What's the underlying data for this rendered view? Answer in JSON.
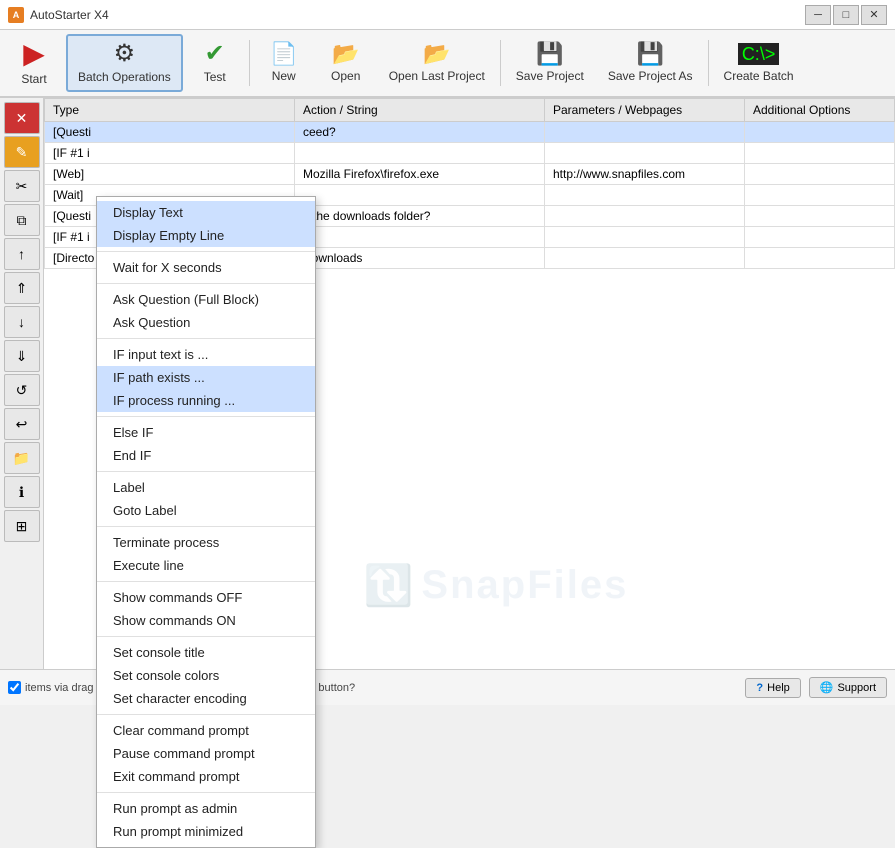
{
  "app": {
    "title": "AutoStarter X4",
    "title_icon": "A"
  },
  "title_controls": {
    "minimize": "─",
    "maximize": "□",
    "close": "✕"
  },
  "toolbar": {
    "buttons": [
      {
        "id": "start",
        "label": "Start",
        "icon": "▶",
        "color": "#cc2222",
        "active": false
      },
      {
        "id": "batch-ops",
        "label": "Batch Operations",
        "icon": "⚙",
        "color": "#555",
        "active": true
      },
      {
        "id": "test",
        "label": "Test",
        "icon": "✔",
        "color": "#339933",
        "active": false
      },
      {
        "id": "new",
        "label": "New",
        "icon": "📄",
        "color": "#555",
        "active": false
      },
      {
        "id": "open",
        "label": "Open",
        "icon": "📂",
        "color": "#cc8800",
        "active": false
      },
      {
        "id": "open-last",
        "label": "Open Last Project",
        "icon": "📂",
        "color": "#cc8800",
        "active": false
      },
      {
        "id": "save",
        "label": "Save Project",
        "icon": "💾",
        "color": "#555",
        "active": false
      },
      {
        "id": "save-as",
        "label": "Save Project As",
        "icon": "💾",
        "color": "#555",
        "active": false
      },
      {
        "id": "create-batch",
        "label": "Create Batch",
        "icon": "🖥",
        "color": "#333",
        "active": false
      }
    ]
  },
  "table": {
    "headers": [
      "Type",
      "Action / String",
      "Parameters / Webpages",
      "Additional Options"
    ],
    "rows": [
      {
        "type": "[Questi",
        "action": "ceed?",
        "params": "",
        "options": ""
      },
      {
        "type": "[IF #1 i",
        "action": "",
        "params": "",
        "options": ""
      },
      {
        "type": "[Web]",
        "action": "Mozilla Firefox\\firefox.exe",
        "params": "http://www.snapfiles.com",
        "options": ""
      },
      {
        "type": "[Wait]",
        "action": "",
        "params": "",
        "options": ""
      },
      {
        "type": "[Questi",
        "action": "n the downloads folder?",
        "params": "",
        "options": ""
      },
      {
        "type": "[IF #1 i",
        "action": "",
        "params": "",
        "options": ""
      },
      {
        "type": "[Directo",
        "action": "Downloads",
        "params": "",
        "options": ""
      }
    ]
  },
  "sidebar_buttons": [
    {
      "id": "delete",
      "icon": "✕",
      "class": "red",
      "tooltip": "Delete"
    },
    {
      "id": "edit",
      "icon": "✎",
      "class": "orange",
      "tooltip": "Edit"
    },
    {
      "id": "scissors",
      "icon": "✂",
      "class": "",
      "tooltip": "Cut"
    },
    {
      "id": "copy",
      "icon": "⧉",
      "class": "",
      "tooltip": "Copy"
    },
    {
      "id": "up",
      "icon": "↑",
      "class": "",
      "tooltip": "Move Up"
    },
    {
      "id": "double-up",
      "icon": "⇑",
      "class": "",
      "tooltip": "Move to Top"
    },
    {
      "id": "down",
      "icon": "↓",
      "class": "",
      "tooltip": "Move Down"
    },
    {
      "id": "double-down",
      "icon": "⇓",
      "class": "",
      "tooltip": "Move to Bottom"
    },
    {
      "id": "refresh",
      "icon": "↺",
      "class": "",
      "tooltip": "Refresh"
    },
    {
      "id": "back",
      "icon": "↩",
      "class": "",
      "tooltip": "Undo"
    },
    {
      "id": "folder",
      "icon": "📁",
      "class": "",
      "tooltip": "Folder"
    },
    {
      "id": "info",
      "icon": "ℹ",
      "class": "",
      "tooltip": "Info"
    },
    {
      "id": "grid",
      "icon": "⊞",
      "class": "",
      "tooltip": "Grid"
    }
  ],
  "dropdown_menu": {
    "items": [
      {
        "id": "display-text",
        "label": "Display Text",
        "separator_after": false,
        "highlighted": true
      },
      {
        "id": "display-empty-line",
        "label": "Display Empty Line",
        "separator_after": true,
        "highlighted": true
      },
      {
        "id": "wait-for-x",
        "label": "Wait for X seconds",
        "separator_after": true,
        "highlighted": false
      },
      {
        "id": "ask-question-full",
        "label": "Ask Question (Full Block)",
        "separator_after": false,
        "highlighted": false
      },
      {
        "id": "ask-question",
        "label": "Ask Question",
        "separator_after": true,
        "highlighted": false
      },
      {
        "id": "if-input-text",
        "label": "IF input text is ...",
        "separator_after": false,
        "highlighted": false
      },
      {
        "id": "if-path-exists",
        "label": "IF path exists ...",
        "separator_after": false,
        "highlighted": true
      },
      {
        "id": "if-process-running",
        "label": "IF process running ...",
        "separator_after": true,
        "highlighted": true
      },
      {
        "id": "else-if",
        "label": "Else IF",
        "separator_after": false,
        "highlighted": false
      },
      {
        "id": "end-if",
        "label": "End IF",
        "separator_after": true,
        "highlighted": false
      },
      {
        "id": "label",
        "label": "Label",
        "separator_after": false,
        "highlighted": false
      },
      {
        "id": "goto-label",
        "label": "Goto Label",
        "separator_after": true,
        "highlighted": false
      },
      {
        "id": "terminate-process",
        "label": "Terminate process",
        "separator_after": false,
        "highlighted": false
      },
      {
        "id": "execute-line",
        "label": "Execute line",
        "separator_after": true,
        "highlighted": false
      },
      {
        "id": "show-commands-off",
        "label": "Show commands OFF",
        "separator_after": false,
        "highlighted": false
      },
      {
        "id": "show-commands-on",
        "label": "Show commands ON",
        "separator_after": true,
        "highlighted": false
      },
      {
        "id": "set-console-title",
        "label": "Set console title",
        "separator_after": false,
        "highlighted": false
      },
      {
        "id": "set-console-colors",
        "label": "Set console colors",
        "separator_after": false,
        "highlighted": false
      },
      {
        "id": "set-char-encoding",
        "label": "Set character encoding",
        "separator_after": true,
        "highlighted": false
      },
      {
        "id": "clear-command-prompt",
        "label": "Clear command prompt",
        "separator_after": false,
        "highlighted": false
      },
      {
        "id": "pause-command-prompt",
        "label": "Pause command prompt",
        "separator_after": false,
        "highlighted": false
      },
      {
        "id": "exit-command-prompt",
        "label": "Exit command prompt",
        "separator_after": true,
        "highlighted": false
      },
      {
        "id": "run-prompt-admin",
        "label": "Run prompt as admin",
        "separator_after": false,
        "highlighted": false
      },
      {
        "id": "run-prompt-minimized",
        "label": "Run prompt minimized",
        "separator_after": false,
        "highlighted": false
      }
    ]
  },
  "bottom_bar": {
    "drag_text": "items via drag and drop?",
    "delete_text": "Delete items with right mouse button?",
    "help_label": "Help",
    "support_label": "Support"
  },
  "watermark": {
    "text": "SnapFiles",
    "symbol": "🔃"
  }
}
